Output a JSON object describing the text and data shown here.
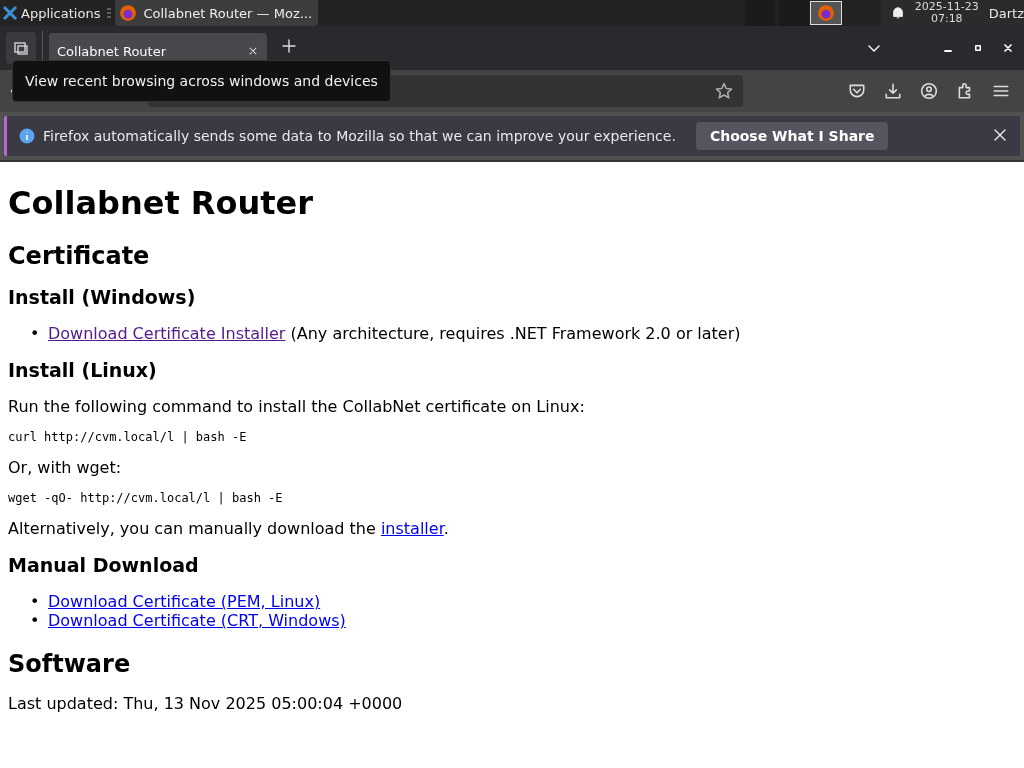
{
  "taskbar": {
    "menu_label": "Applications",
    "windows": [
      {
        "title": "Collabnet Router — Moz...",
        "selected": true
      }
    ],
    "date": "2025-11-23",
    "time": "07:18",
    "user": "Dartz"
  },
  "tabs": [
    {
      "label": "Collabnet Router",
      "selected": true
    }
  ],
  "tooltip": "View recent browsing across windows and devices",
  "notification": {
    "message": "Firefox automatically sends some data to Mozilla so that we can improve your experience.",
    "button": "Choose What I Share"
  },
  "page": [
    {
      "kind": "h1",
      "text": "Collabnet Router"
    },
    {
      "kind": "h2",
      "text": "Certificate"
    },
    {
      "kind": "h3",
      "text": "Install (Windows)"
    },
    {
      "kind": "list",
      "items": [
        {
          "marker": "•",
          "parts": [
            {
              "link": "Download Certificate Installer",
              "visited": true
            },
            {
              "text": " (Any architecture, requires .NET Framework 2.0 or later)"
            }
          ]
        }
      ]
    },
    {
      "kind": "h3",
      "text": "Install (Linux)"
    },
    {
      "kind": "p",
      "parts": [
        {
          "text": "Run the following command to install the CollabNet certificate on Linux:"
        }
      ]
    },
    {
      "kind": "code",
      "text": "curl http://cvm.local/l | bash -E"
    },
    {
      "kind": "p",
      "parts": [
        {
          "text": "Or, with wget:"
        }
      ]
    },
    {
      "kind": "code",
      "text": "wget -qO- http://cvm.local/l | bash -E"
    },
    {
      "kind": "p",
      "parts": [
        {
          "text": "Alternatively, you can manually download the "
        },
        {
          "link": "installer",
          "visited": false
        },
        {
          "text": "."
        }
      ]
    },
    {
      "kind": "h3",
      "text": "Manual Download"
    },
    {
      "kind": "list",
      "items": [
        {
          "marker": "•",
          "parts": [
            {
              "link": "Download Certificate (PEM, Linux)",
              "visited": false
            }
          ]
        },
        {
          "marker": "•",
          "parts": [
            {
              "link": "Download Certificate (CRT, Windows)",
              "visited": false
            }
          ]
        }
      ]
    },
    {
      "kind": "h2",
      "text": "Software"
    },
    {
      "kind": "p",
      "parts": [
        {
          "text": "Last updated: Thu, 13 Nov 2025 05:00:04 +0000"
        }
      ]
    }
  ]
}
